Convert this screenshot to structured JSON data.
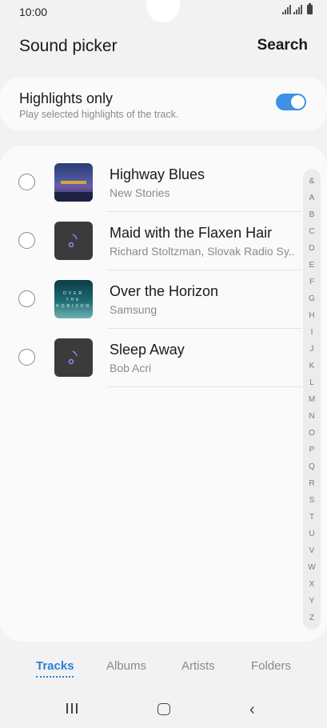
{
  "status_bar": {
    "time": "10:00"
  },
  "header": {
    "title": "Sound picker",
    "search_label": "Search"
  },
  "highlights": {
    "title": "Highlights only",
    "subtitle": "Play selected highlights of the track.",
    "enabled": true
  },
  "tracks": [
    {
      "title": "Highway Blues",
      "artist": "New Stories",
      "art": "album-art-highway-blues"
    },
    {
      "title": "Maid with the Flaxen Hair",
      "artist": "Richard Stoltzman, Slovak Radio Sy..",
      "art": "music-note-icon"
    },
    {
      "title": "Over the Horizon",
      "artist": "Samsung",
      "art": "album-art-over-the-horizon"
    },
    {
      "title": "Sleep Away",
      "artist": "Bob Acri",
      "art": "music-note-icon"
    }
  ],
  "index_letters": [
    "&",
    "A",
    "B",
    "C",
    "D",
    "E",
    "F",
    "G",
    "H",
    "I",
    "J",
    "K",
    "L",
    "M",
    "N",
    "O",
    "P",
    "Q",
    "R",
    "S",
    "T",
    "U",
    "V",
    "W",
    "X",
    "Y",
    "Z"
  ],
  "tabs": [
    {
      "label": "Tracks",
      "active": true
    },
    {
      "label": "Albums",
      "active": false
    },
    {
      "label": "Artists",
      "active": false
    },
    {
      "label": "Folders",
      "active": false
    }
  ],
  "colors": {
    "accent": "#2a7fd6",
    "toggle": "#3e91e4"
  }
}
